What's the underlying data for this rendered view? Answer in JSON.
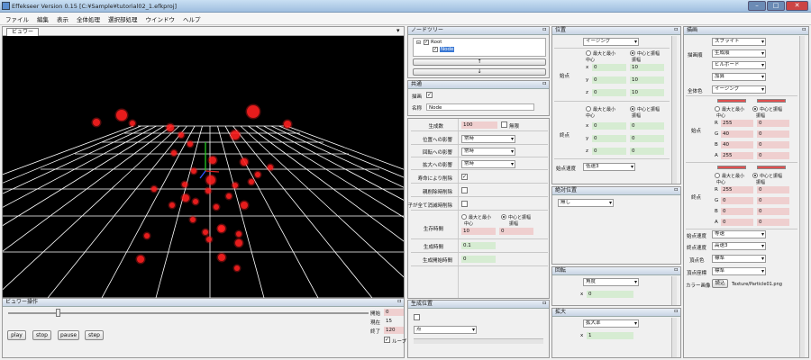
{
  "window": {
    "title": "Effekseer Version 0.15 [C:¥Sample¥tutorial02_1.efkproj]",
    "min": "–",
    "max": "□",
    "close": "✕"
  },
  "menu": [
    "ファイル",
    "編集",
    "表示",
    "全体処理",
    "選択部処理",
    "ウインドウ",
    "ヘルプ"
  ],
  "viewer": {
    "tab": "ビュワー",
    "dropdown_icon": "▾"
  },
  "viewer_ops": {
    "title": "ビュワー操作",
    "pin": "ㅁ",
    "start_label": "開始",
    "start": "0",
    "current_label": "現在",
    "current": "15",
    "end_label": "終了",
    "end": "120",
    "loop": "ループ",
    "buttons": [
      "play",
      "stop",
      "pause",
      "step"
    ]
  },
  "node_tree": {
    "title": "ノードツリー",
    "pin": "ㅁ",
    "root": "Root",
    "node": "Node",
    "up": "↑",
    "down": "↓"
  },
  "common": {
    "title": "共通",
    "pin": "ㅁ",
    "draw_label": "描画",
    "name_label": "名称",
    "name_value": "Node",
    "pin2": "ㅁ"
  },
  "spawn": {
    "rows": [
      {
        "label": "生成数",
        "value": "100",
        "extra": "無限"
      },
      {
        "label": "位置への影響",
        "value": "常時"
      },
      {
        "label": "回転への影響",
        "value": "常時"
      },
      {
        "label": "拡大への影響",
        "value": "常時"
      },
      {
        "label": "寿命により削除"
      },
      {
        "label": "親削除時削除"
      },
      {
        "label": "子が全て消滅時削除"
      }
    ],
    "life_label": "生存時間",
    "radio_a": "最大と最小",
    "radio_b": "中心と振幅",
    "sub_center": "中心",
    "sub_amp": "振幅",
    "life_v1": "10",
    "life_v2": "0",
    "gen_time_label": "生成時間",
    "gen_time": "0.1",
    "gen_start_label": "生成開始時間",
    "gen_start": "0"
  },
  "gen_pos": {
    "title": "生成位置",
    "pin": "ㅁ",
    "select": "点"
  },
  "position": {
    "title": "位置",
    "pin": "ㅁ",
    "mode": "イージング",
    "radio_a": "最大と最小",
    "radio_b": "中心と振幅",
    "sub_center": "中心",
    "sub_amp": "振幅",
    "start_label": "始点",
    "start": [
      [
        "x",
        "0",
        "10"
      ],
      [
        "y",
        "0",
        "10"
      ],
      [
        "z",
        "0",
        "10"
      ]
    ],
    "end_label": "終点",
    "end": [
      [
        "x",
        "0",
        "0"
      ],
      [
        "y",
        "0",
        "0"
      ],
      [
        "z",
        "0",
        "0"
      ]
    ],
    "speed_label": "始点速度",
    "speed": "低速3"
  },
  "abs_pos": {
    "title": "絶対位置",
    "pin": "ㅁ",
    "select": "無し"
  },
  "rotation": {
    "title": "回転",
    "pin": "ㅁ",
    "select": "角度",
    "x_label": "x",
    "x": "0"
  },
  "scale": {
    "title": "拡大",
    "pin": "ㅁ",
    "select": "拡大率",
    "x_label": "x",
    "x": "1"
  },
  "draw": {
    "title": "描画",
    "pin": "ㅁ",
    "type": "スプライト",
    "order_label": "描画順",
    "order": "生成順",
    "billboard": "ビルボード",
    "blend": "加算",
    "color_label": "全体色",
    "color_mode": "イージング",
    "radio_a": "最大と最小",
    "radio_b": "中心と振幅",
    "sub_center": "中心",
    "sub_amp": "振幅",
    "start_label": "始点",
    "start": [
      [
        "R",
        "255",
        "0"
      ],
      [
        "G",
        "40",
        "0"
      ],
      [
        "B",
        "40",
        "0"
      ],
      [
        "A",
        "255",
        "0"
      ]
    ],
    "end_label": "終点",
    "end": [
      [
        "R",
        "255",
        "0"
      ],
      [
        "G",
        "0",
        "0"
      ],
      [
        "B",
        "0",
        "0"
      ],
      [
        "A",
        "0",
        "0"
      ]
    ],
    "start_speed_label": "始点速度",
    "start_speed": "等速",
    "end_speed_label": "終点速度",
    "end_speed": "高速3",
    "vcolor_label": "頂点色",
    "vcolor": "標準",
    "vcoord_label": "頂点座標",
    "vcoord": "標準",
    "image_label": "カラー画像",
    "image_button": "読込",
    "image_path": "Texture/Particle01.png"
  },
  "colors": {
    "particle": "#ff2020",
    "grid": "#ffffff",
    "bg": "#000000"
  }
}
